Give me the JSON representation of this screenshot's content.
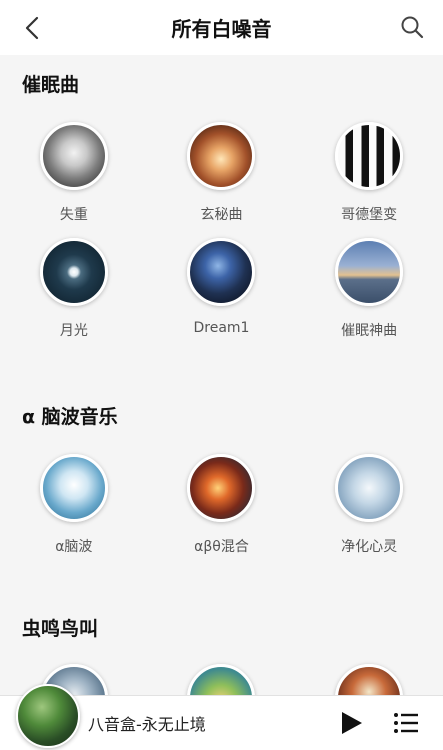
{
  "header": {
    "title": "所有白噪音",
    "back_icon": "chevron-left-icon",
    "search_icon": "search-icon"
  },
  "sections": [
    {
      "title": "催眠曲",
      "items": [
        {
          "label": "失重",
          "icon": "astronaut-image"
        },
        {
          "label": "玄秘曲",
          "icon": "glowing-orb-image"
        },
        {
          "label": "哥德堡变",
          "icon": "piano-keys-image"
        },
        {
          "label": "月光",
          "icon": "moon-image"
        },
        {
          "label": "Dream1",
          "icon": "night-landscape-image"
        },
        {
          "label": "催眠神曲",
          "icon": "swan-lake-image"
        }
      ]
    },
    {
      "title": "α 脑波音乐",
      "items": [
        {
          "label": "α脑波",
          "icon": "brain-image"
        },
        {
          "label": "αβθ混合",
          "icon": "nebula-image"
        },
        {
          "label": "净化心灵",
          "icon": "frost-image"
        }
      ]
    },
    {
      "title": "虫鸣鸟叫",
      "items": [
        {
          "label": "",
          "icon": "bird-image"
        },
        {
          "label": "",
          "icon": "frog-image"
        },
        {
          "label": "",
          "icon": "forest-image"
        }
      ]
    }
  ],
  "player": {
    "track": "八音盒-永无止境",
    "play_icon": "play-icon",
    "playlist_icon": "playlist-icon"
  }
}
